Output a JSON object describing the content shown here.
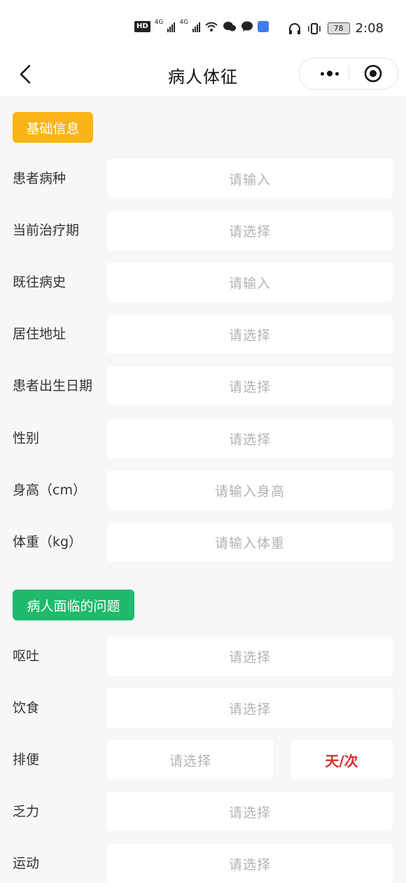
{
  "status_bar": {
    "network_1": "4G",
    "network_2": "4G",
    "battery": "78",
    "time": "2:08"
  },
  "nav": {
    "title": "病人体征",
    "back_icon": "chevron-left-icon",
    "more_icon": "more-dots-icon",
    "close_icon": "target-circle-icon"
  },
  "basic_section": {
    "tag": "基础信息",
    "tag_color": "#fab415",
    "fields": [
      {
        "label": "患者病种",
        "placeholder": "请输入"
      },
      {
        "label": "当前治疗期",
        "placeholder": "请选择"
      },
      {
        "label": "既往病史",
        "placeholder": "请输入"
      },
      {
        "label": "居住地址",
        "placeholder": "请选择"
      },
      {
        "label": "患者出生日期",
        "placeholder": "请选择"
      },
      {
        "label": "性别",
        "placeholder": "请选择"
      },
      {
        "label": "身高（cm）",
        "placeholder": "请输入身高"
      },
      {
        "label": "体重（kg）",
        "placeholder": "请输入体重"
      }
    ]
  },
  "problem_section": {
    "tag": "病人面临的问题",
    "tag_color": "#1fba6b",
    "fields": [
      {
        "label": "呕吐",
        "placeholder": "请选择"
      },
      {
        "label": "饮食",
        "placeholder": "请选择"
      },
      {
        "label": "排便",
        "placeholder": "请选择",
        "unit": "天/次"
      },
      {
        "label": "乏力",
        "placeholder": "请选择"
      },
      {
        "label": "运动",
        "placeholder": "请选择"
      }
    ]
  }
}
